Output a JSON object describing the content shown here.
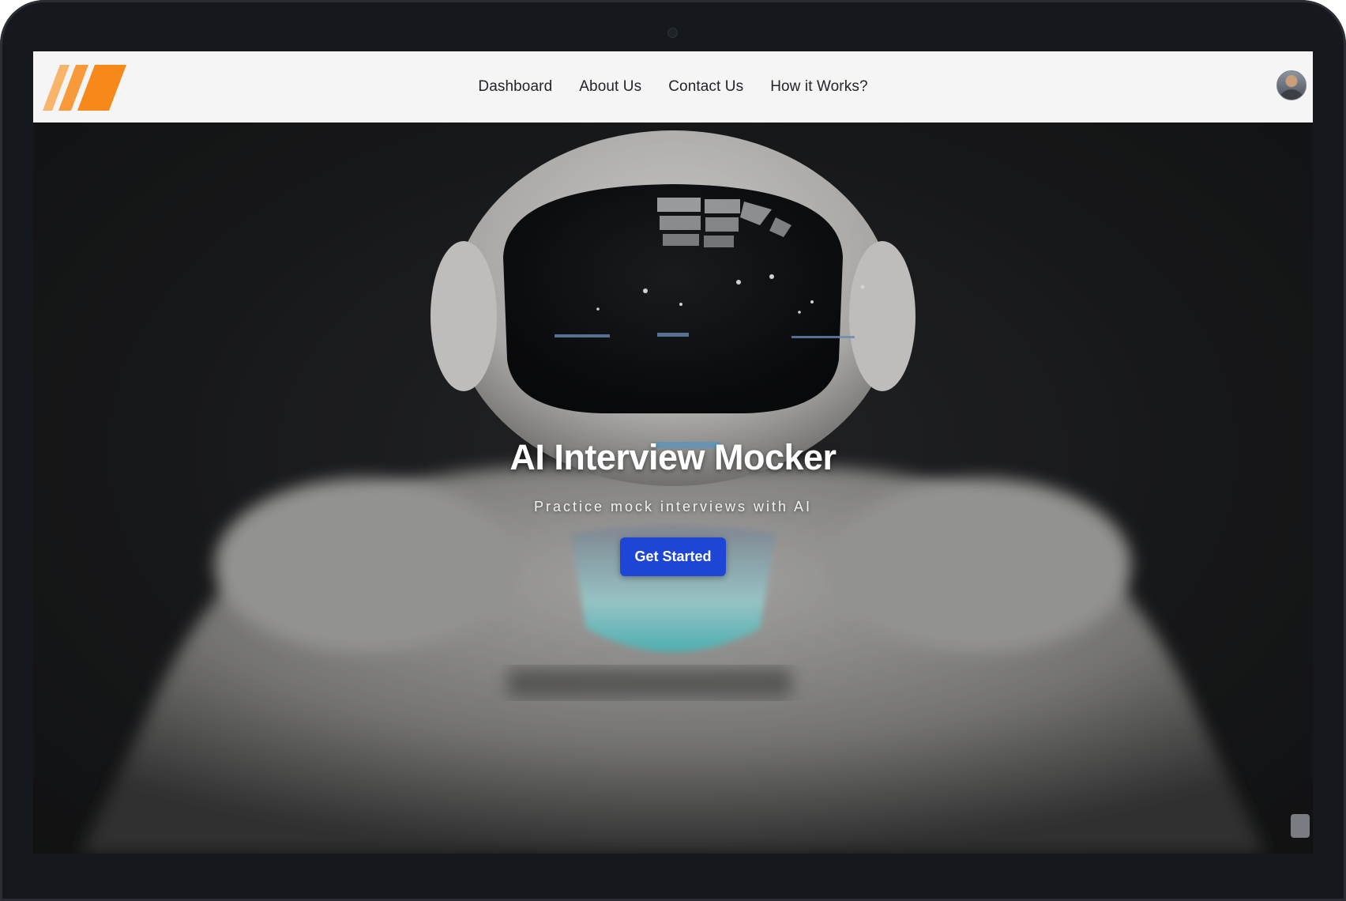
{
  "nav": {
    "logo_icon": "stripes-logo-icon",
    "links": [
      "Dashboard",
      "About Us",
      "Contact Us",
      "How it Works?"
    ],
    "avatar_icon": "user-avatar-icon"
  },
  "hero": {
    "title": "AI Interview Mocker",
    "subtitle": "Practice mock interviews with AI",
    "cta_label": "Get Started"
  },
  "colors": {
    "logo_orange": "#f7881a",
    "logo_orange_light": "#f9b46b",
    "cta_blue": "#1d46d6",
    "navbar_bg": "#f5f5f6",
    "device_frame": "#15181c"
  }
}
